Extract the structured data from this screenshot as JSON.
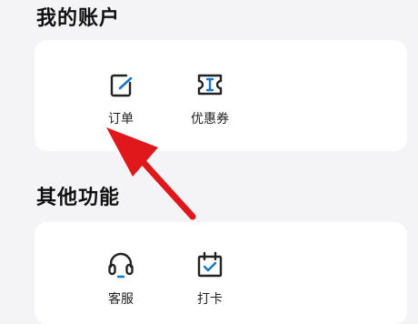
{
  "account_section": {
    "title": "我的账户",
    "items": [
      {
        "label": "订单",
        "icon": "order-edit-icon"
      },
      {
        "label": "优惠券",
        "icon": "coupon-ticket-icon"
      }
    ]
  },
  "other_section": {
    "title": "其他功能",
    "items": [
      {
        "label": "客服",
        "icon": "headset-icon"
      },
      {
        "label": "打卡",
        "icon": "calendar-check-icon"
      }
    ]
  },
  "colors": {
    "accent_blue": "#1677c8",
    "icon_dark": "#222222",
    "annotation_arrow": "#e0181b"
  }
}
